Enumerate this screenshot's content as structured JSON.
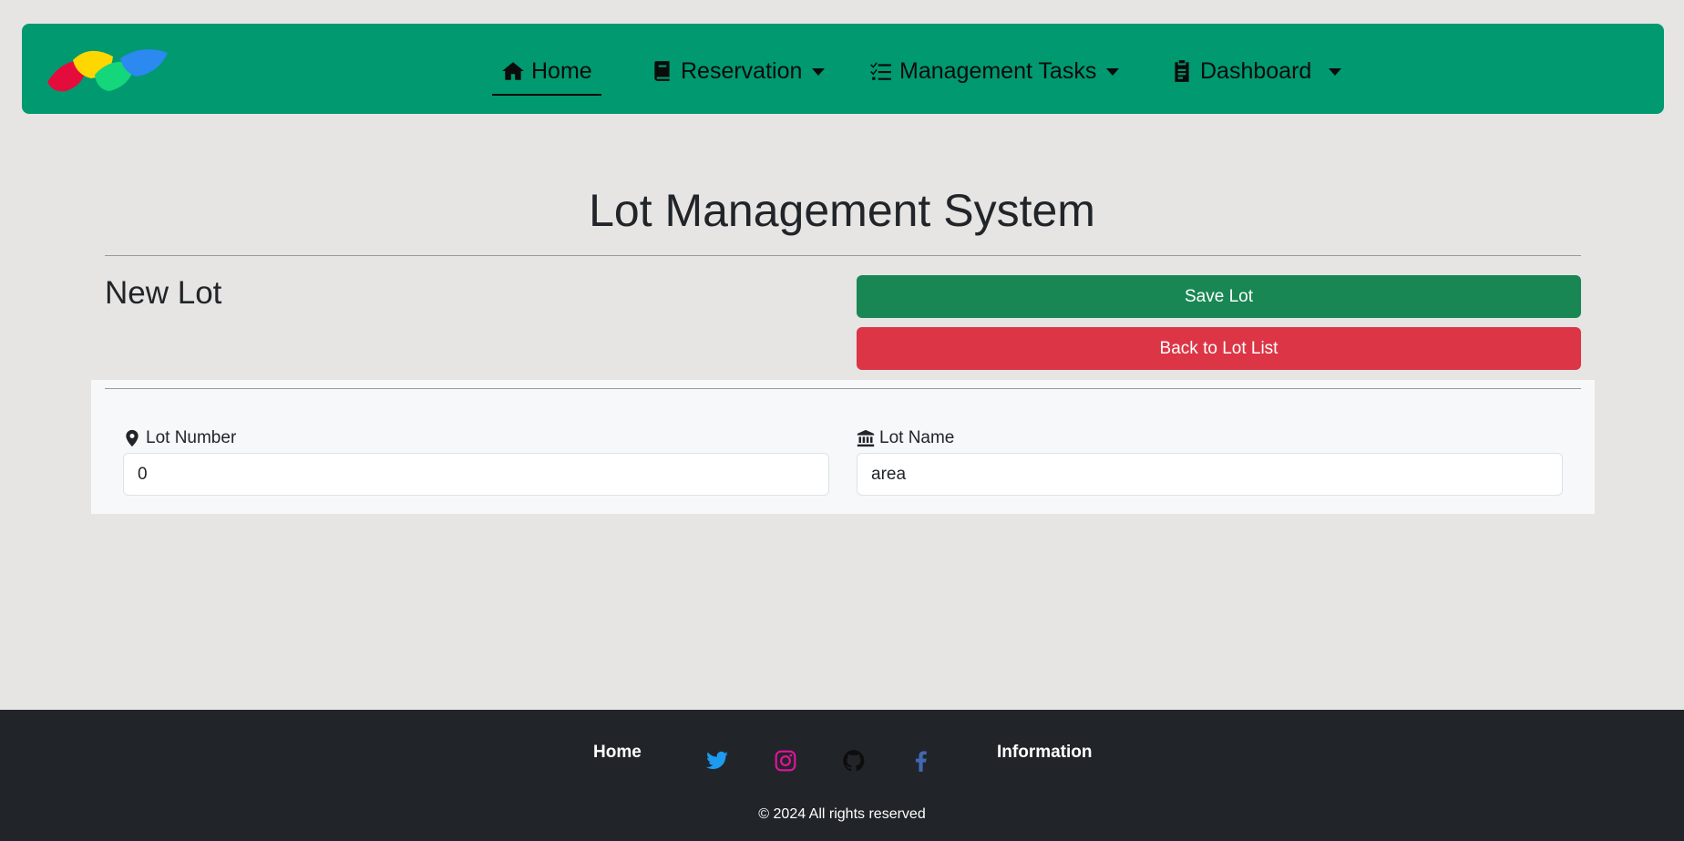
{
  "navbar": {
    "logo_icon": "brand-leaves-logo",
    "items": [
      {
        "label": "Home",
        "icon": "home-icon",
        "active": true,
        "dropdown": false
      },
      {
        "label": "Reservation",
        "icon": "book-icon",
        "active": false,
        "dropdown": true
      },
      {
        "label": "Management Tasks",
        "icon": "list-check-icon",
        "active": false,
        "dropdown": true
      },
      {
        "label": "Dashboard",
        "icon": "clipboard-icon",
        "active": false,
        "dropdown": true
      }
    ],
    "bg_color": "#009970"
  },
  "main": {
    "page_title": "Lot Management System",
    "section_title": "New Lot",
    "save_button": "Save Lot",
    "back_button": "Back to Lot List",
    "fields": {
      "lot_number": {
        "label": "Lot Number",
        "value": "0",
        "icon": "map-marker-icon"
      },
      "lot_name": {
        "label": "Lot Name",
        "value": "area",
        "icon": "bank-icon"
      }
    },
    "colors": {
      "save": "#198754",
      "back": "#dc3545"
    }
  },
  "footer": {
    "home_link": "Home",
    "info_link": "Information",
    "social": [
      {
        "name": "twitter-icon",
        "color": "#1d9bf0"
      },
      {
        "name": "instagram-icon",
        "color": "#e1139a"
      },
      {
        "name": "github-icon",
        "color": "#0d0d0d"
      },
      {
        "name": "facebook-icon",
        "color": "#4267b2"
      }
    ],
    "copyright": "© 2024 All rights reserved"
  }
}
